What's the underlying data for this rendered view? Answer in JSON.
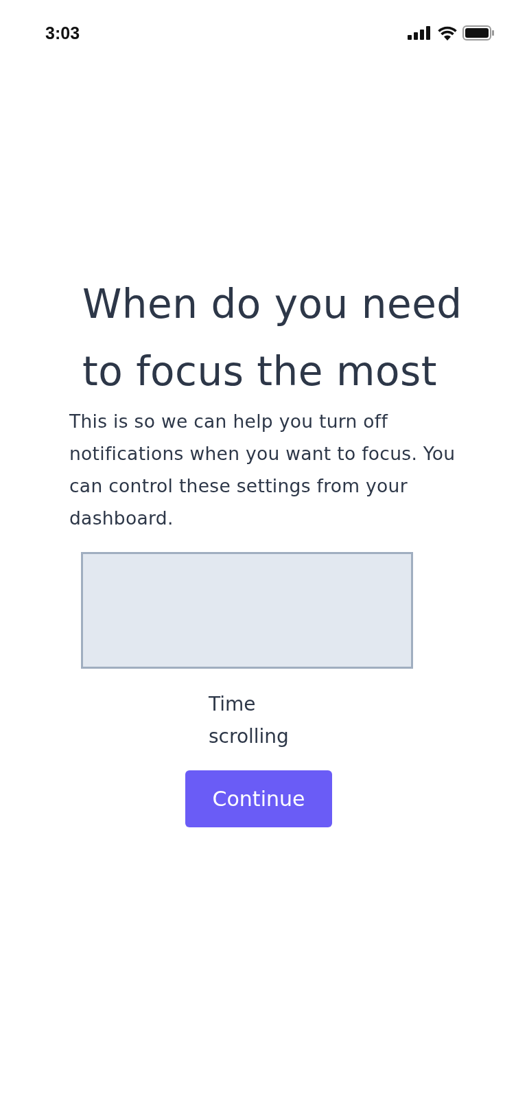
{
  "status_bar": {
    "time": "3:03"
  },
  "title": "When do you need to focus the most",
  "description": "This is so we can help you turn off notifications when you want to focus. You can control these settings from your dashboard.",
  "caption": "Time scrolling",
  "button": "Continue"
}
